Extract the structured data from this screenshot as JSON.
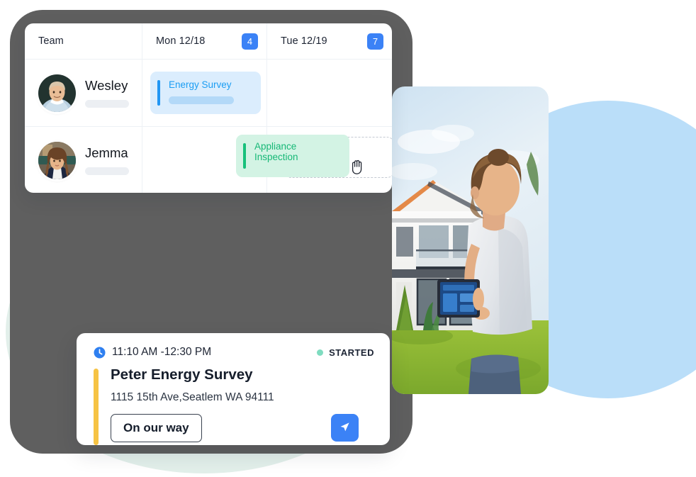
{
  "schedule": {
    "columns": [
      {
        "label": "Team",
        "badge": null
      },
      {
        "label": "Mon 12/18",
        "badge": "4"
      },
      {
        "label": "Tue 12/19",
        "badge": "7"
      }
    ],
    "rows": [
      {
        "name": "Wesley",
        "events": [
          {
            "title": "Energy Survey",
            "day": "Mon 12/18",
            "color": "#1b9df3"
          }
        ]
      },
      {
        "name": "Jemma",
        "events": [
          {
            "title": "Appliance Inspection",
            "day": "Tue 12/19",
            "color": "#17b877"
          }
        ]
      }
    ],
    "cursor_icon": "grab-hand-icon",
    "badge_color": "#3b82f6"
  },
  "job": {
    "clock_icon": "clock-icon",
    "time": "11:10 AM -12:30 PM",
    "status": "STARTED",
    "status_color": "#7fdcc0",
    "title": "Peter Energy Survey",
    "address": "1115 15th Ave,Seatlem WA 94111",
    "action_label": "On our way",
    "send_icon": "send-paper-plane-icon",
    "send_color": "#3b82f6",
    "accent_color": "#f6c344"
  },
  "decor": {
    "frame_color": "#5f5f5f",
    "mint_blob_color": "#e2efea",
    "blue_blob_color": "#badef9",
    "photo_alt": "technician-with-tablet-outside-modern-house"
  }
}
